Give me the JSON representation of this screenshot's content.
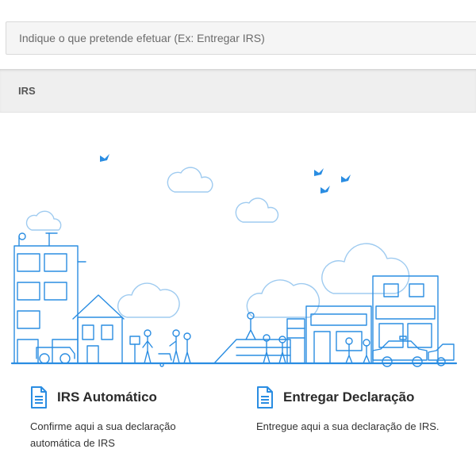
{
  "search": {
    "placeholder": "Indique o que pretende efetuar (Ex: Entregar IRS)"
  },
  "section": {
    "title": "IRS"
  },
  "cards": [
    {
      "icon": "document-icon",
      "title": "IRS Automático",
      "description": "Confirme aqui a sua declaração automática de IRS"
    },
    {
      "icon": "document-icon",
      "title": "Entregar Declaração",
      "description": "Entregue aqui a sua declaração de IRS."
    }
  ],
  "colors": {
    "accent": "#2a8de2",
    "header_bg": "#efefef",
    "search_bg": "#f5f5f5"
  }
}
